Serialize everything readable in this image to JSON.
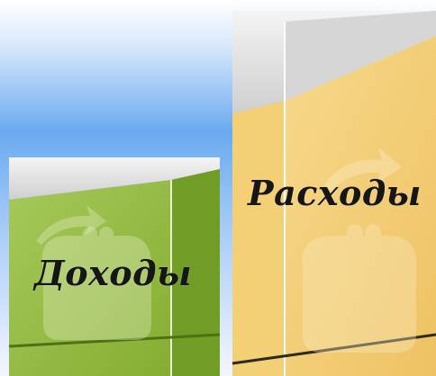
{
  "labels": {
    "income": "Доходы",
    "expense": "Расходы"
  },
  "icons": {
    "wallet": "wallet-icon",
    "arrow": "curved-arrow-icon"
  },
  "colors": {
    "sky_top": "#ffffff",
    "sky_mid": "#6aaaf0",
    "sky_bottom": "#f0f4ff",
    "income_front": "#8fb83a",
    "income_side": "#6b9a22",
    "expense_front": "#f0c86a",
    "expense_side": "#d9a83c",
    "top_face": "#dcdcdc"
  }
}
